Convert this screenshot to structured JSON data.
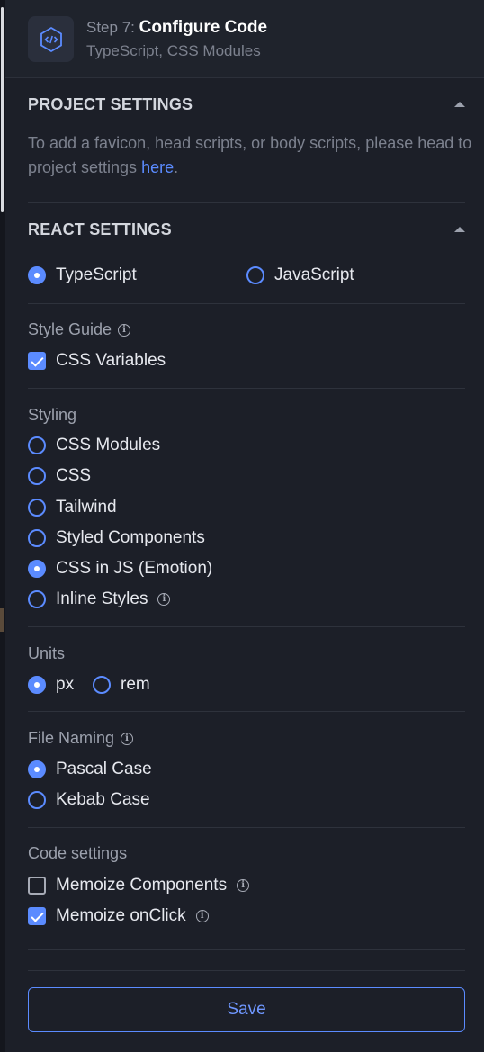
{
  "header": {
    "step_prefix": "Step 7: ",
    "step_title": "Configure Code",
    "subtitle": "TypeScript, CSS Modules",
    "icon": "code-icon"
  },
  "project_settings": {
    "title": "PROJECT SETTINGS",
    "desc_text": "To add a favicon, head scripts, or body scripts, please head to project settings ",
    "link_text": "here",
    "desc_end": "."
  },
  "react_settings": {
    "title": "REACT SETTINGS",
    "languages": [
      {
        "label": "TypeScript",
        "selected": true
      },
      {
        "label": "JavaScript",
        "selected": false
      }
    ]
  },
  "style_guide": {
    "label": "Style Guide",
    "options": [
      {
        "label": "CSS Variables",
        "checked": true
      }
    ]
  },
  "styling": {
    "label": "Styling",
    "options": [
      {
        "label": "CSS Modules",
        "selected": false
      },
      {
        "label": "CSS",
        "selected": false
      },
      {
        "label": "Tailwind",
        "selected": false
      },
      {
        "label": "Styled Components",
        "selected": false
      },
      {
        "label": "CSS in JS (Emotion)",
        "selected": true
      },
      {
        "label": "Inline Styles",
        "selected": false
      }
    ]
  },
  "units": {
    "label": "Units",
    "options": [
      {
        "label": "px",
        "selected": true
      },
      {
        "label": "rem",
        "selected": false
      }
    ]
  },
  "file_naming": {
    "label": "File Naming",
    "options": [
      {
        "label": "Pascal Case",
        "selected": true
      },
      {
        "label": "Kebab Case",
        "selected": false
      }
    ]
  },
  "code_settings": {
    "label": "Code settings",
    "options": [
      {
        "label": "Memoize Components",
        "checked": false
      },
      {
        "label": "Memoize onClick",
        "checked": true
      }
    ]
  },
  "footer": {
    "save_label": "Save"
  },
  "colors": {
    "accent": "#5b8bff",
    "background": "#1c1f28",
    "muted_text": "#7c818e"
  }
}
